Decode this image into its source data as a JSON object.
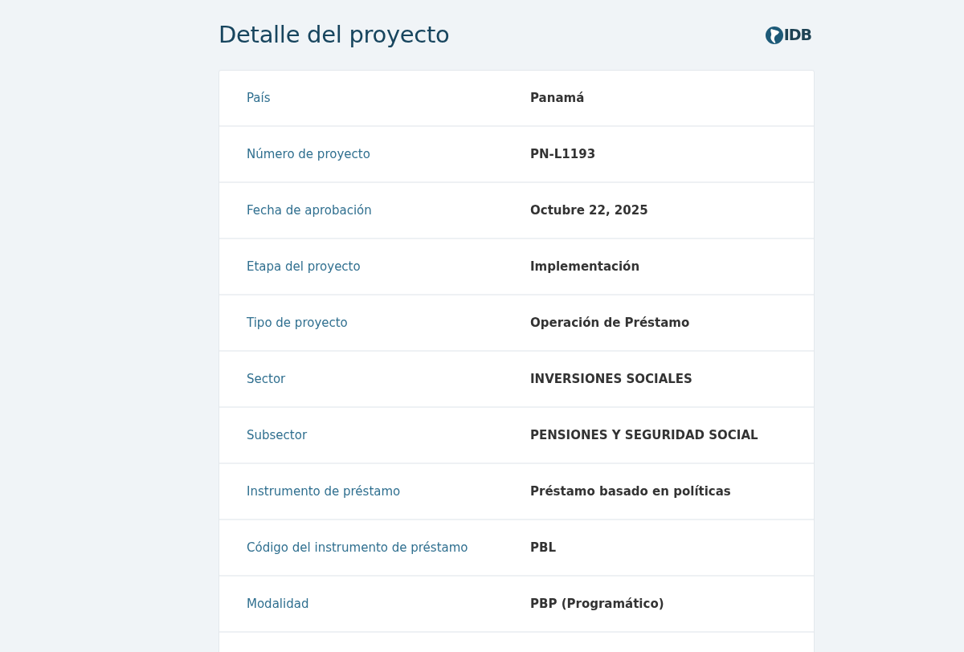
{
  "header": {
    "title": "Detalle del proyecto",
    "logo_text": "IDB"
  },
  "details": [
    {
      "label": "País",
      "value": "Panamá"
    },
    {
      "label": "Número de proyecto",
      "value": "PN-L1193"
    },
    {
      "label": "Fecha de aprobación",
      "value": "Octubre 22, 2025"
    },
    {
      "label": "Etapa del proyecto",
      "value": "Implementación"
    },
    {
      "label": "Tipo de proyecto",
      "value": "Operación de Préstamo"
    },
    {
      "label": "Sector",
      "value": "INVERSIONES SOCIALES"
    },
    {
      "label": "Subsector",
      "value": "PENSIONES Y SEGURIDAD SOCIAL"
    },
    {
      "label": "Instrumento de préstamo",
      "value": "Préstamo basado en políticas"
    },
    {
      "label": "Código del instrumento de préstamo",
      "value": "PBL"
    },
    {
      "label": "Modalidad",
      "value": "PBP (Programático)"
    }
  ]
}
